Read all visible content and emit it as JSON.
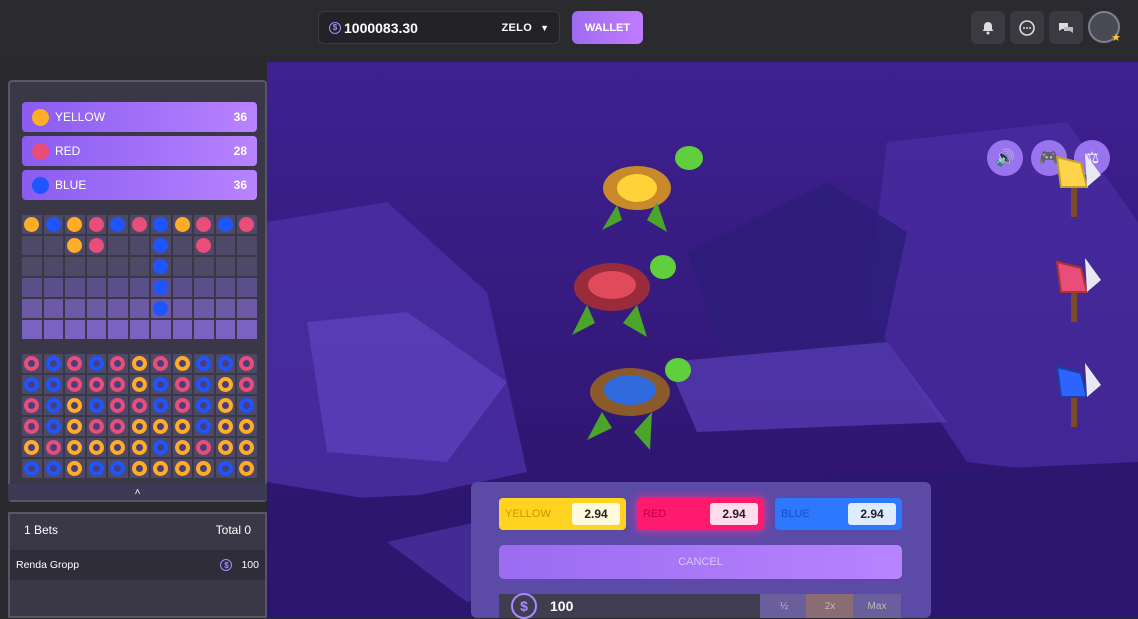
{
  "header": {
    "balance": "1000083.30",
    "currency": "ZELO",
    "wallet_label": "WALLET"
  },
  "colors": {
    "yellow": "#ffad27",
    "red": "#e94d7a",
    "blue": "#1f55ff",
    "accent": "#9d6cf2"
  },
  "tallies": [
    {
      "label": "YELLOW",
      "count": "36",
      "color": "#ffad27"
    },
    {
      "label": "RED",
      "count": "28",
      "color": "#e94d7a"
    },
    {
      "label": "BLUE",
      "count": "36",
      "color": "#1f55ff"
    }
  ],
  "recent_grid": [
    [
      "Y",
      "B",
      "Y",
      "R",
      "B",
      "R",
      "B",
      "Y",
      "R",
      "B",
      "R"
    ],
    [
      "",
      "",
      "Y",
      "R",
      "",
      "",
      "B",
      "",
      "R",
      "",
      ""
    ],
    [
      "",
      "",
      "",
      "",
      "",
      "",
      "B",
      "",
      "",
      "",
      ""
    ],
    [
      "",
      "",
      "",
      "",
      "",
      "",
      "B",
      "",
      "",
      "",
      ""
    ],
    [
      "",
      "",
      "",
      "",
      "",
      "",
      "B",
      "",
      "",
      "",
      ""
    ],
    [
      "",
      "",
      "",
      "",
      "",
      "",
      "",
      "",
      "",
      "",
      ""
    ]
  ],
  "history_grid": [
    [
      "R",
      "B",
      "R",
      "B",
      "R",
      "Y",
      "R",
      "Y",
      "B",
      "B",
      "R"
    ],
    [
      "B",
      "B",
      "R",
      "R",
      "R",
      "Y",
      "B",
      "R",
      "B",
      "Y",
      "R"
    ],
    [
      "R",
      "B",
      "Y",
      "B",
      "R",
      "R",
      "B",
      "R",
      "B",
      "Y",
      "B"
    ],
    [
      "R",
      "B",
      "Y",
      "R",
      "R",
      "Y",
      "Y",
      "Y",
      "B",
      "Y",
      "Y"
    ],
    [
      "Y",
      "R",
      "Y",
      "Y",
      "Y",
      "Y",
      "B",
      "Y",
      "R",
      "Y",
      "Y"
    ],
    [
      "B",
      "B",
      "Y",
      "B",
      "B",
      "Y",
      "Y",
      "Y",
      "Y",
      "B",
      "Y"
    ]
  ],
  "bets": {
    "count_label": "1 Bets",
    "total_label": "Total 0",
    "rows": [
      {
        "player": "Renda Gropp",
        "amount": "100"
      }
    ]
  },
  "odds": [
    {
      "label": "YELLOW",
      "value": "2.94"
    },
    {
      "label": "RED",
      "value": "2.94"
    },
    {
      "label": "BLUE",
      "value": "2.94"
    }
  ],
  "controls": {
    "cancel_label": "CANCEL",
    "amount": "100",
    "multipliers": [
      "½",
      "2x",
      "Max"
    ]
  }
}
